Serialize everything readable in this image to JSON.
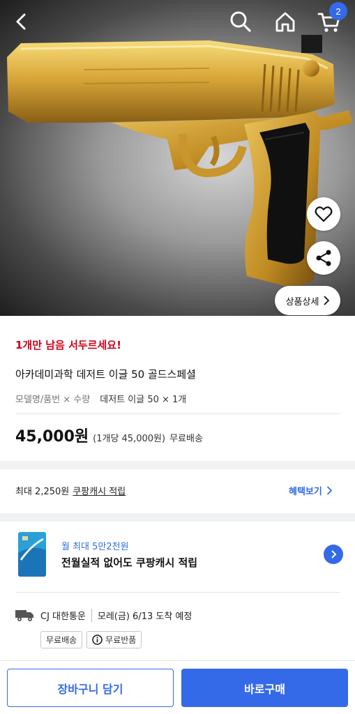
{
  "header": {
    "back_icon": "chevron-left-icon",
    "search_icon": "search-icon",
    "home_icon": "home-icon",
    "cart_icon": "cart-icon",
    "cart_count": "2"
  },
  "hero": {
    "image_icon": "product-photo",
    "favorite_icon": "heart-icon",
    "share_icon": "share-icon",
    "detail_label": "상품상세"
  },
  "product": {
    "stock_warning": "1개만 남음 서두르세요!",
    "title": "아카데미과학 데저트 이글 50 골드스페셜",
    "model_label": "모델명/품번 × 수량",
    "model_value": "데저트 이글 50 × 1개",
    "price": "45,000원",
    "unit_price": "(1개당 45,000원)",
    "shipping": "무료배송"
  },
  "reward": {
    "prefix": "최대 2,250원",
    "link": "쿠팡캐시 적립",
    "benefit_label": "혜택보기"
  },
  "promo": {
    "sub": "월 최대 5만2천원",
    "main": "전월실적 없어도 쿠팡캐시 적립"
  },
  "delivery": {
    "carrier": "CJ 대한통운",
    "date": "모레(금) 6/13 도착 예정",
    "tag_free_shipping": "무료배송",
    "tag_free_return": "무료반품"
  },
  "actions": {
    "add_to_cart": "장바구니 담기",
    "buy_now": "바로구매"
  },
  "colors": {
    "accent": "#3469e8",
    "warning": "#d0021b",
    "link": "#2f6de0"
  }
}
